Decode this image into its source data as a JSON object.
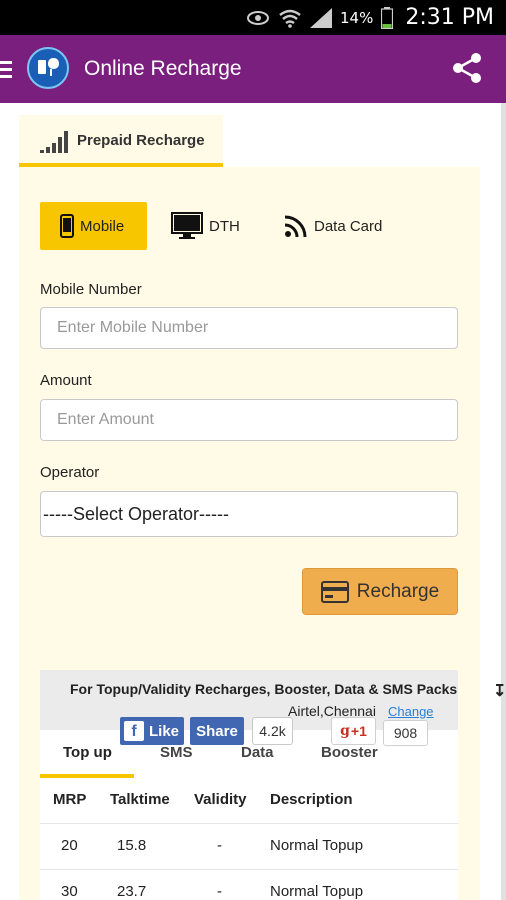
{
  "status_bar": {
    "battery_percent": "14%",
    "time": "2:31 PM",
    "icons": [
      "eye-icon",
      "wifi-icon",
      "signal-icon",
      "battery-icon"
    ]
  },
  "app_bar": {
    "title": "Online Recharge",
    "icons": [
      "menu-icon",
      "app-logo",
      "share-icon"
    ],
    "color": "#7b1f7e"
  },
  "tabs": {
    "prepaid_label": "Prepaid Recharge"
  },
  "recharge_types": {
    "mobile": "Mobile",
    "dth": "DTH",
    "data_card": "Data Card"
  },
  "form": {
    "mobile_label": "Mobile Number",
    "mobile_placeholder": "Enter Mobile Number",
    "amount_label": "Amount",
    "amount_placeholder": "Enter Amount",
    "operator_label": "Operator",
    "operator_selected": "-----Select Operator-----",
    "recharge_button": "Recharge"
  },
  "plans": {
    "header": "For Topup/Validity Recharges, Booster, Data & SMS Packs",
    "location": "Airtel,Chennai",
    "change_link": "Change",
    "tabs": [
      "Top up",
      "SMS",
      "Data",
      "Booster"
    ],
    "columns": [
      "MRP",
      "Talktime",
      "Validity",
      "Description"
    ],
    "rows": [
      [
        "20",
        "15.8",
        "-",
        "Normal Topup"
      ],
      [
        "30",
        "23.7",
        "-",
        "Normal Topup"
      ]
    ]
  },
  "social": {
    "like": "Like",
    "share": "Share",
    "fb_count": "4.2k",
    "gplus": "+1",
    "gplus_count": "908"
  },
  "colors": {
    "accent": "#f7c600",
    "panel": "#fffbe6",
    "button": "#f0ad4e"
  }
}
